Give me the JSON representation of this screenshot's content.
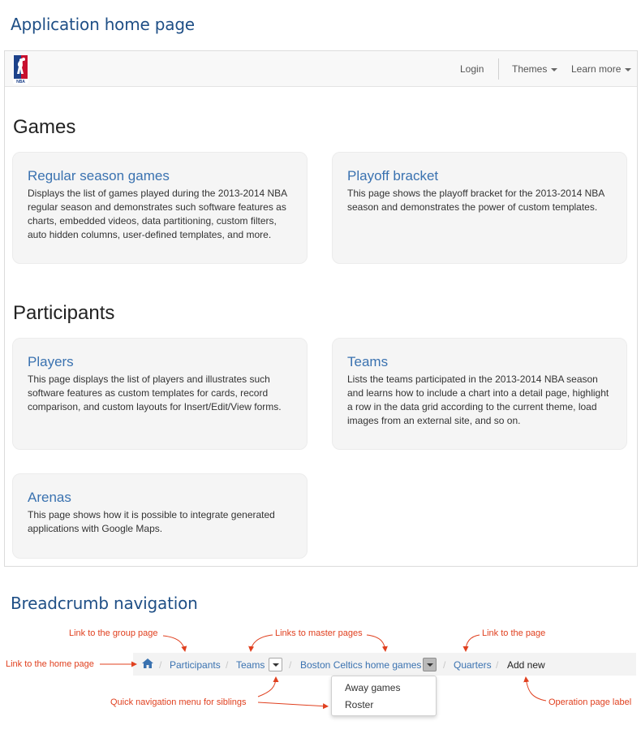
{
  "sections": {
    "app_title": "Application home page",
    "breadcrumb_title": "Breadcrumb navigation"
  },
  "navbar": {
    "logo_icon": "nba-logo",
    "login": "Login",
    "themes": "Themes",
    "learn_more": "Learn more"
  },
  "groups": {
    "games": {
      "title": "Games",
      "cards": [
        {
          "title": "Regular season games",
          "description": "Displays the list of games played during the 2013-2014 NBA regular season and demonstrates such software features as charts, embedded videos, data partitioning, custom filters, auto hidden columns, user-defined templates, and more."
        },
        {
          "title": "Playoff bracket",
          "description": "This page shows the playoff bracket for the 2013-2014 NBA season and demonstrates the power of custom templates."
        }
      ]
    },
    "participants": {
      "title": "Participants",
      "cards": [
        {
          "title": "Players",
          "description": "This page displays the list of players and illustrates such software features as custom templates for cards, record comparison, and custom layouts for Insert/Edit/View forms."
        },
        {
          "title": "Teams",
          "description": "Lists the teams participated in the 2013-2014 NBA season and learns how to include a chart into a detail page, highlight a row in the data grid according to the current theme, load images from an external site, and so on."
        },
        {
          "title": "Arenas",
          "description": "This page shows how it is possible to integrate generated applications with Google Maps."
        }
      ]
    }
  },
  "breadcrumb": {
    "home_icon": "home-icon",
    "separator": "/",
    "items": [
      "Participants",
      "Teams",
      "Boston Celtics home games",
      "Quarters"
    ],
    "current": "Add new",
    "dropdown_items": [
      "Away games",
      "Roster"
    ]
  },
  "annotations": {
    "group_page": "Link to the group page",
    "master_pages": "Links to master pages",
    "the_page": "Link to the page",
    "home_page": "Link to the home page",
    "quick_nav": "Quick navigation menu for siblings",
    "operation_label": "Operation page label"
  },
  "colors": {
    "section_title": "#1f4f86",
    "link": "#3a72b0",
    "annotation": "#e0401f",
    "card_bg": "#f5f5f5"
  }
}
